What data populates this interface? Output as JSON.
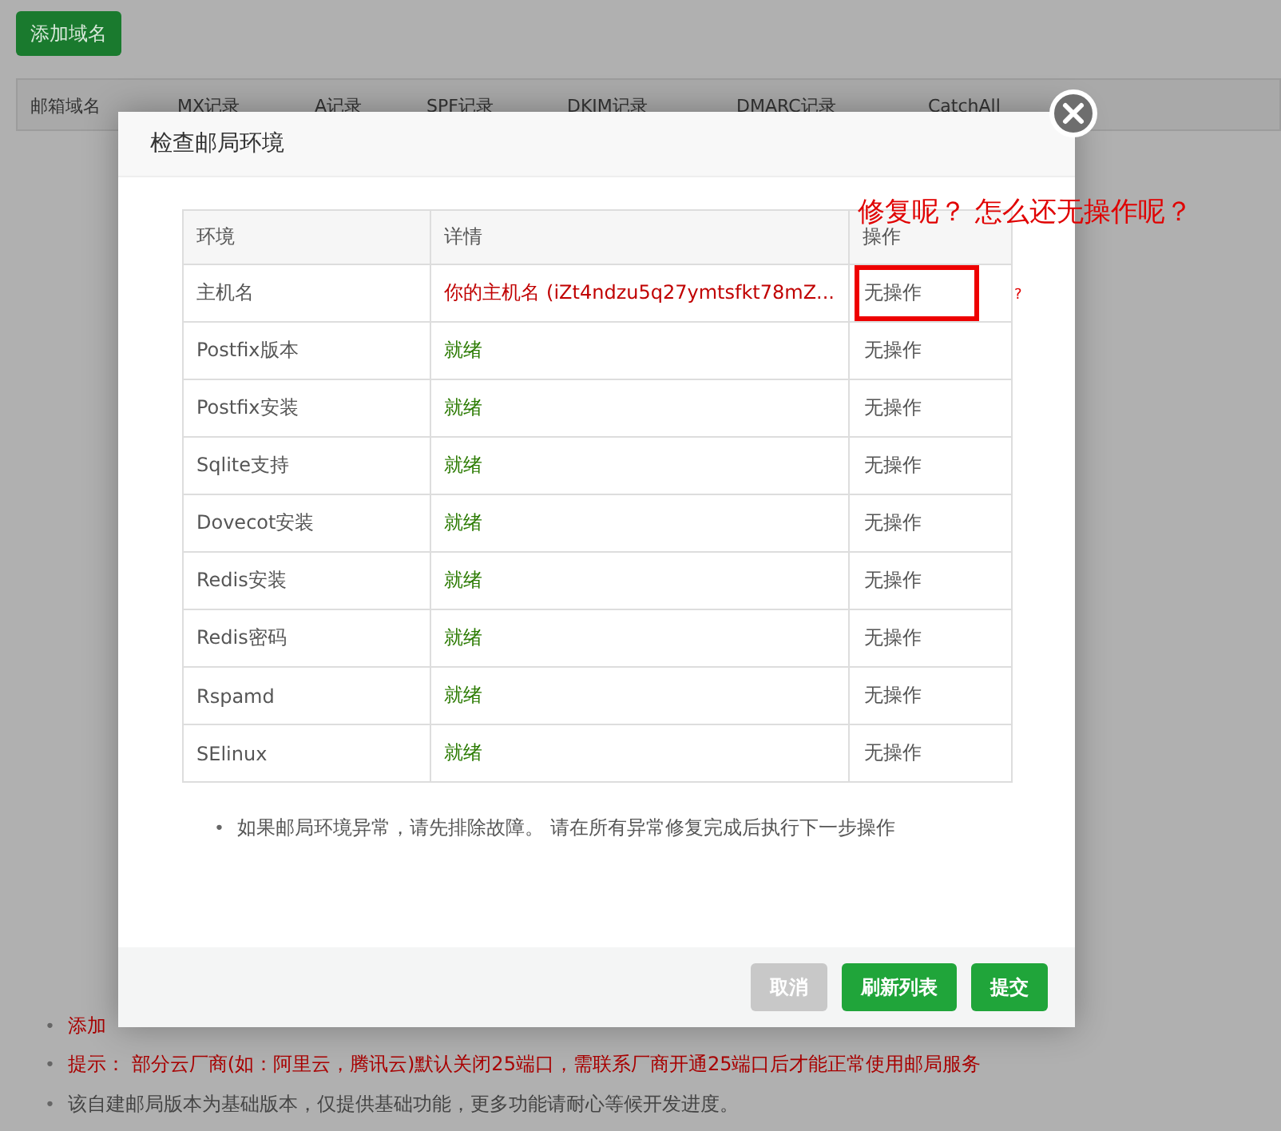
{
  "background": {
    "add_button": "添加域名",
    "columns": [
      "邮箱域名",
      "MX记录",
      "A记录",
      "SPF记录",
      "DKIM记录",
      "DMARC记录",
      "CatchAll"
    ],
    "notes": [
      {
        "marker": "•",
        "text": "添加",
        "kind": "warning"
      },
      {
        "marker": "•",
        "text": "提示： 部分云厂商(如：阿里云，腾讯云)默认关闭25端口，需联系厂商开通25端口后才能正常使用邮局服务",
        "kind": "warning"
      },
      {
        "marker": "•",
        "text": "该自建邮局版本为基础版本，仅提供基础功能，更多功能请耐心等候开发进度。",
        "kind": "info"
      }
    ]
  },
  "dialog": {
    "title": "检查邮局环境",
    "table": {
      "columns": [
        "环境",
        "详情",
        "操作"
      ],
      "rows": [
        {
          "env": "主机名",
          "detail": "你的主机名 (iZt4ndzu5q27ymtsfkt78mZ...",
          "color": "#c00000",
          "action": "无操作",
          "highlighted": true
        },
        {
          "env": "Postfix版本",
          "detail": "就绪",
          "color": "#2a7a00",
          "action": "无操作",
          "highlighted": false
        },
        {
          "env": "Postfix安装",
          "detail": "就绪",
          "color": "#2a7a00",
          "action": "无操作",
          "highlighted": false
        },
        {
          "env": "Sqlite支持",
          "detail": "就绪",
          "color": "#2a7a00",
          "action": "无操作",
          "highlighted": false
        },
        {
          "env": "Dovecot安装",
          "detail": "就绪",
          "color": "#2a7a00",
          "action": "无操作",
          "highlighted": false
        },
        {
          "env": "Redis安装",
          "detail": "就绪",
          "color": "#2a7a00",
          "action": "无操作",
          "highlighted": false
        },
        {
          "env": "Redis密码",
          "detail": "就绪",
          "color": "#2a7a00",
          "action": "无操作",
          "highlighted": false
        },
        {
          "env": "Rspamd",
          "detail": "就绪",
          "color": "#2a7a00",
          "action": "无操作",
          "highlighted": false
        },
        {
          "env": "SElinux",
          "detail": "就绪",
          "color": "#2a7a00",
          "action": "无操作",
          "highlighted": false
        }
      ]
    },
    "note_marker": "•",
    "note": "如果邮局环境异常，请先排除故障。 请在所有异常修复完成后执行下一步操作",
    "buttons": [
      {
        "label": "取消",
        "disabled": true
      },
      {
        "label": "刷新列表",
        "disabled": false
      },
      {
        "label": "提交",
        "disabled": false
      }
    ]
  },
  "annotation": {
    "text": "修复呢？ 怎么还无操作呢？",
    "mark": "?"
  }
}
